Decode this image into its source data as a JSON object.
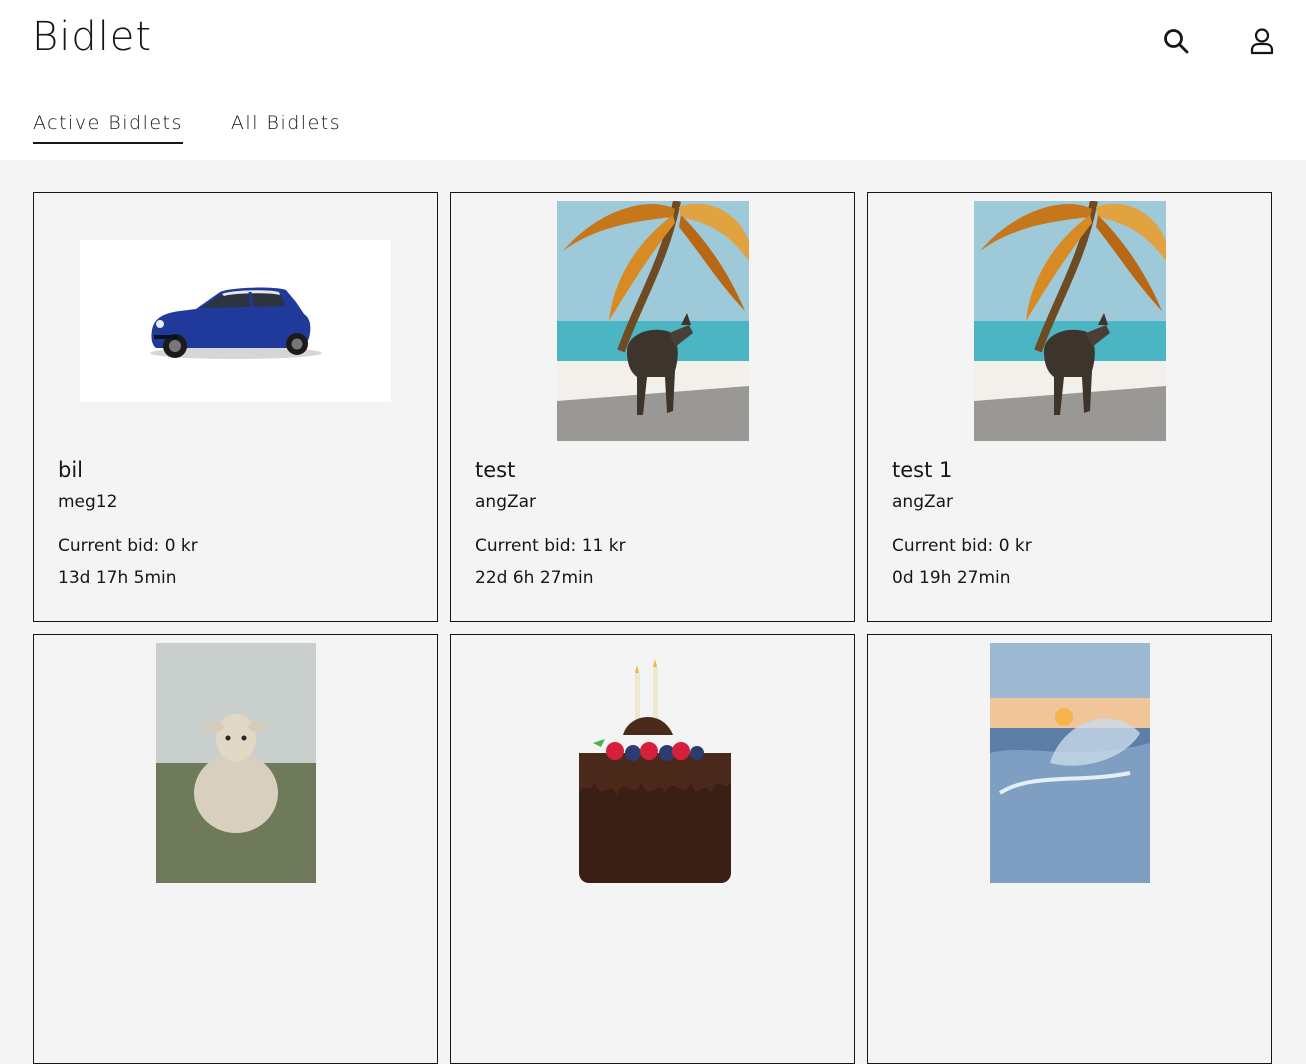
{
  "header": {
    "brand": "Bidlet",
    "icons": [
      "search-icon",
      "user-icon"
    ]
  },
  "tabs": [
    {
      "label": "Active Bidlets",
      "active": true
    },
    {
      "label": "All Bidlets",
      "active": false
    }
  ],
  "bid_prefix": "Current bid: ",
  "cards": [
    {
      "title": "bil",
      "seller": "meg12",
      "current_bid": "Current bid: 0 kr",
      "time_left": "13d 17h 5min",
      "image": "blue-car"
    },
    {
      "title": "test",
      "seller": "angZar",
      "current_bid": "Current bid: 11 kr",
      "time_left": "22d 6h 27min",
      "image": "donkey-palm-beach"
    },
    {
      "title": "test 1",
      "seller": "angZar",
      "current_bid": "Current bid: 0 kr",
      "time_left": "0d 19h 27min",
      "image": "donkey-palm-beach"
    },
    {
      "image": "sheep"
    },
    {
      "image": "chocolate-cake"
    },
    {
      "image": "ice-sunset"
    }
  ],
  "colors": {
    "page_bg": "#f4f4f4",
    "header_bg": "#ffffff",
    "text": "#161616",
    "card_border": "#161616",
    "car_blue": "#1f3a9a"
  }
}
